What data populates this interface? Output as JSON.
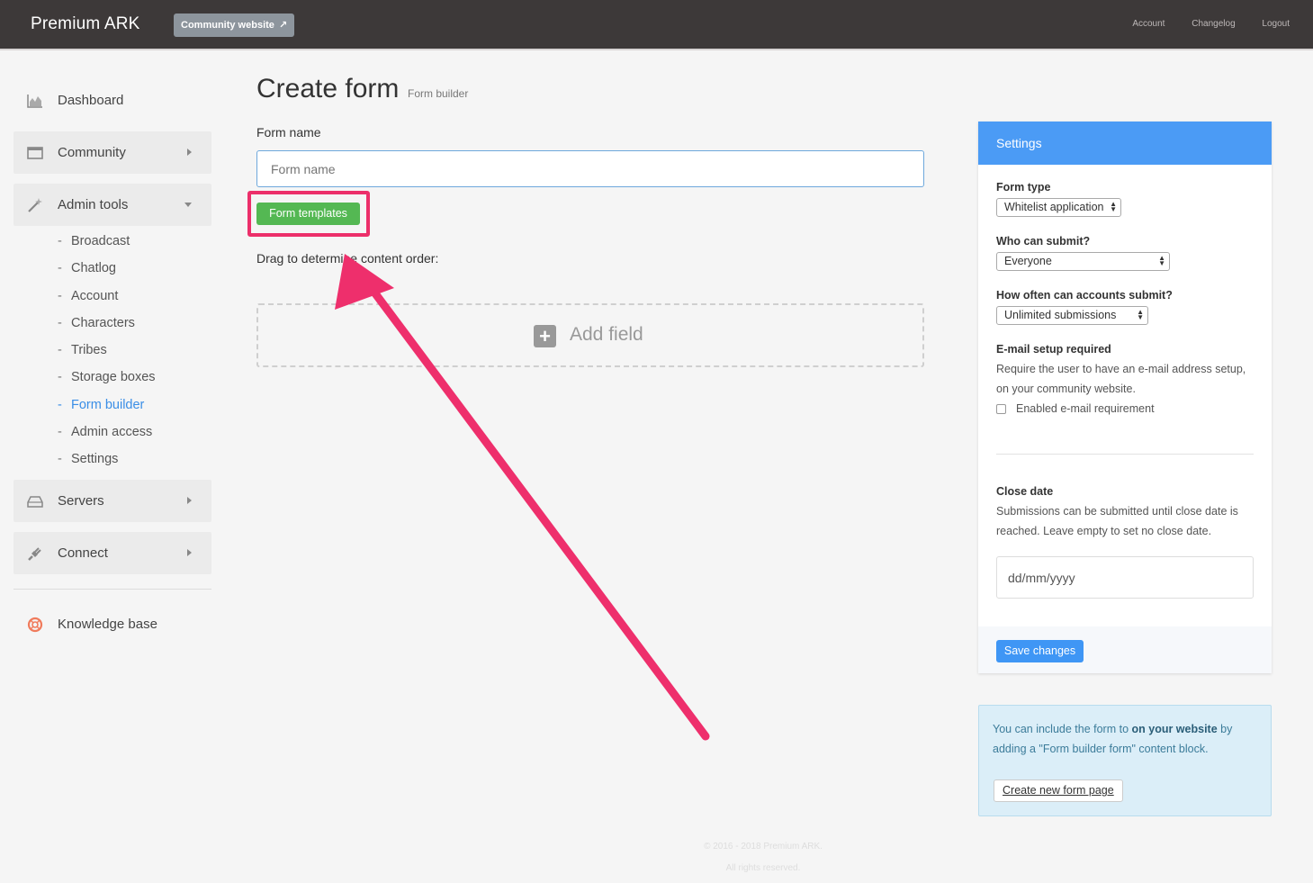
{
  "header": {
    "brand": "Premium ARK",
    "community_button": "Community website",
    "nav": [
      "Account",
      "Changelog",
      "Logout"
    ]
  },
  "sidebar": {
    "items": [
      {
        "label": "Dashboard",
        "icon": "chart-area-icon"
      },
      {
        "label": "Community",
        "icon": "window-icon"
      },
      {
        "label": "Admin tools",
        "icon": "magic-wand-icon"
      },
      {
        "label": "Servers",
        "icon": "hard-drive-icon"
      },
      {
        "label": "Connect",
        "icon": "plug-icon"
      },
      {
        "label": "Knowledge base",
        "icon": "life-ring-icon"
      }
    ],
    "submenu": [
      "Broadcast",
      "Chatlog",
      "Account",
      "Characters",
      "Tribes",
      "Storage boxes",
      "Form builder",
      "Admin access",
      "Settings"
    ],
    "active_submenu": "Form builder"
  },
  "main": {
    "title": "Create form",
    "subtitle": "Form builder",
    "form_name_label": "Form name",
    "form_name_placeholder": "Form name",
    "form_name_value": "",
    "templates_button": "Form templates",
    "drag_text": "Drag to determine content order:",
    "add_field": "Add field"
  },
  "settings": {
    "header": "Settings",
    "form_type_label": "Form type",
    "form_type_value": "Whitelist application",
    "who_label": "Who can submit?",
    "who_value": "Everyone",
    "often_label": "How often can accounts submit?",
    "often_value": "Unlimited submissions",
    "email_label": "E-mail setup required",
    "email_desc": "Require the user to have an e-mail address setup, on your community website.",
    "email_checkbox": "Enabled e-mail requirement",
    "email_checked": false,
    "close_label": "Close date",
    "close_desc": "Submissions can be submitted until close date is reached. Leave empty to set no close date.",
    "close_placeholder": "dd/mm/yyyy",
    "save_button": "Save changes"
  },
  "info": {
    "text_before": "You can include the form to ",
    "text_bold": "on your website",
    "text_after": " by adding a \"Form builder form\" content block.",
    "button": "Create new form page"
  },
  "footer": {
    "line1": "© 2016 - 2018 Premium ARK.",
    "line2": "All rights reserved."
  },
  "colors": {
    "topbar": "#3d3939",
    "accent_blue": "#4b9bf5",
    "green": "#54b853",
    "highlight_pink": "#ec2f6a"
  }
}
